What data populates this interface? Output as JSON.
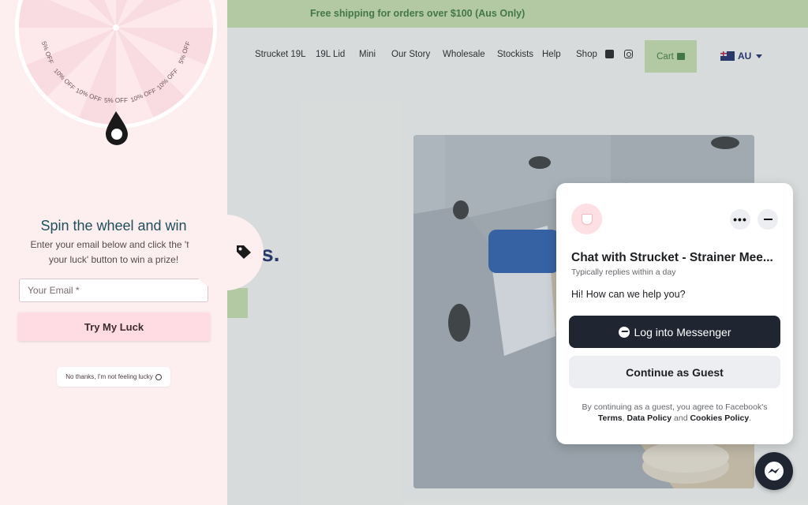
{
  "announcement": "Free shipping for orders over $100 (Aus Only)",
  "nav": {
    "items": [
      "Strucket 19L",
      "19L Lid",
      "Mini",
      "Our Story",
      "Wholesale",
      "Stockists",
      "Help",
      "Shop"
    ],
    "social_icons": [
      "facebook-icon",
      "instagram-icon"
    ],
    "cart_label": "Cart",
    "locale_label": "AU"
  },
  "hero": {
    "headline_fragment": "ses."
  },
  "spin": {
    "wheel_labels": [
      "5% OFF",
      "10% OFF",
      "10% OFF",
      "5% OFF",
      "10% OFF",
      "10% OFF",
      "5% OFF"
    ],
    "title": "Spin the wheel and win",
    "description": "Enter your email below and click the 'try your luck' button to win a prize!",
    "email_placeholder": "Your Email *",
    "try_button": "Try My Luck",
    "no_thanks": "No thanks, I'm not feeling lucky"
  },
  "chat": {
    "title": "Chat with Strucket - Strainer Mee...",
    "subtitle": "Typically replies within a day",
    "greeting": "Hi! How can we help you?",
    "login_button": "Log into Messenger",
    "guest_button": "Continue as Guest",
    "legal_prefix": "By continuing as a guest, you agree to Facebook's",
    "legal_terms": "Terms",
    "legal_sep1": ",",
    "legal_data": "Data Policy",
    "legal_and": "and",
    "legal_cookies": "Cookies Policy",
    "legal_end": "."
  },
  "colors": {
    "announcement_bg": "#c8e0b0",
    "spin_panel_bg": "#fdeef0",
    "try_button_bg": "#ffdce3",
    "chat_dark_button": "#1f2632"
  }
}
